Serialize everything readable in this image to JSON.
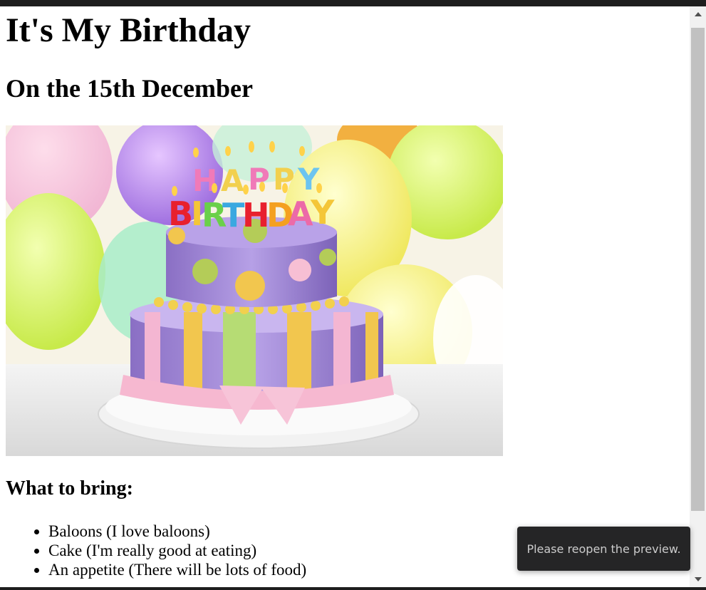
{
  "page": {
    "title": "It's My Birthday",
    "subtitle": "On the 15th December",
    "section_heading": "What to bring:",
    "bring_items": [
      "Baloons (I love baloons)",
      "Cake (I'm really good at eating)",
      "An appetite (There will be lots of food)"
    ]
  },
  "image": {
    "candle_text_top": "HAPPY",
    "candle_text_bottom": "BIRTHDAY"
  },
  "toast": {
    "message": "Please reopen the preview."
  },
  "icons": {
    "scroll_up": "triangle-up-icon",
    "scroll_down": "triangle-down-icon"
  }
}
